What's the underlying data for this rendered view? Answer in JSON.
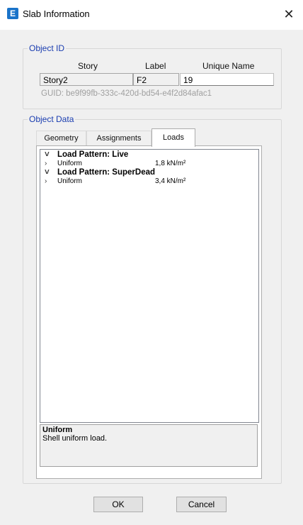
{
  "window": {
    "title": "Slab Information",
    "app_icon": "E",
    "close_glyph": "✕"
  },
  "object_id": {
    "legend": "Object ID",
    "headers": {
      "story": "Story",
      "label": "Label",
      "unique_name": "Unique Name"
    },
    "values": {
      "story": "Story2",
      "label": "F2",
      "unique_name": "19"
    },
    "guid": "GUID:  be9f99fb-333c-420d-bd54-e4f2d84afac1"
  },
  "object_data": {
    "legend": "Object Data",
    "tabs": [
      {
        "label": "Geometry"
      },
      {
        "label": "Assignments"
      },
      {
        "label": "Loads"
      }
    ],
    "active_tab": "Loads",
    "tree": [
      {
        "type": "pattern",
        "chevron": "˅",
        "name": "Load Pattern: Live"
      },
      {
        "type": "item",
        "chevron": "›",
        "name": "Uniform",
        "value": "1,8 kN/m²"
      },
      {
        "type": "pattern",
        "chevron": "˅",
        "name": "Load Pattern: SuperDead"
      },
      {
        "type": "item",
        "chevron": "›",
        "name": "Uniform",
        "value": "3,4 kN/m²"
      }
    ],
    "description": {
      "title": "Uniform",
      "text": "Shell uniform load."
    }
  },
  "buttons": {
    "ok": "OK",
    "cancel": "Cancel"
  }
}
